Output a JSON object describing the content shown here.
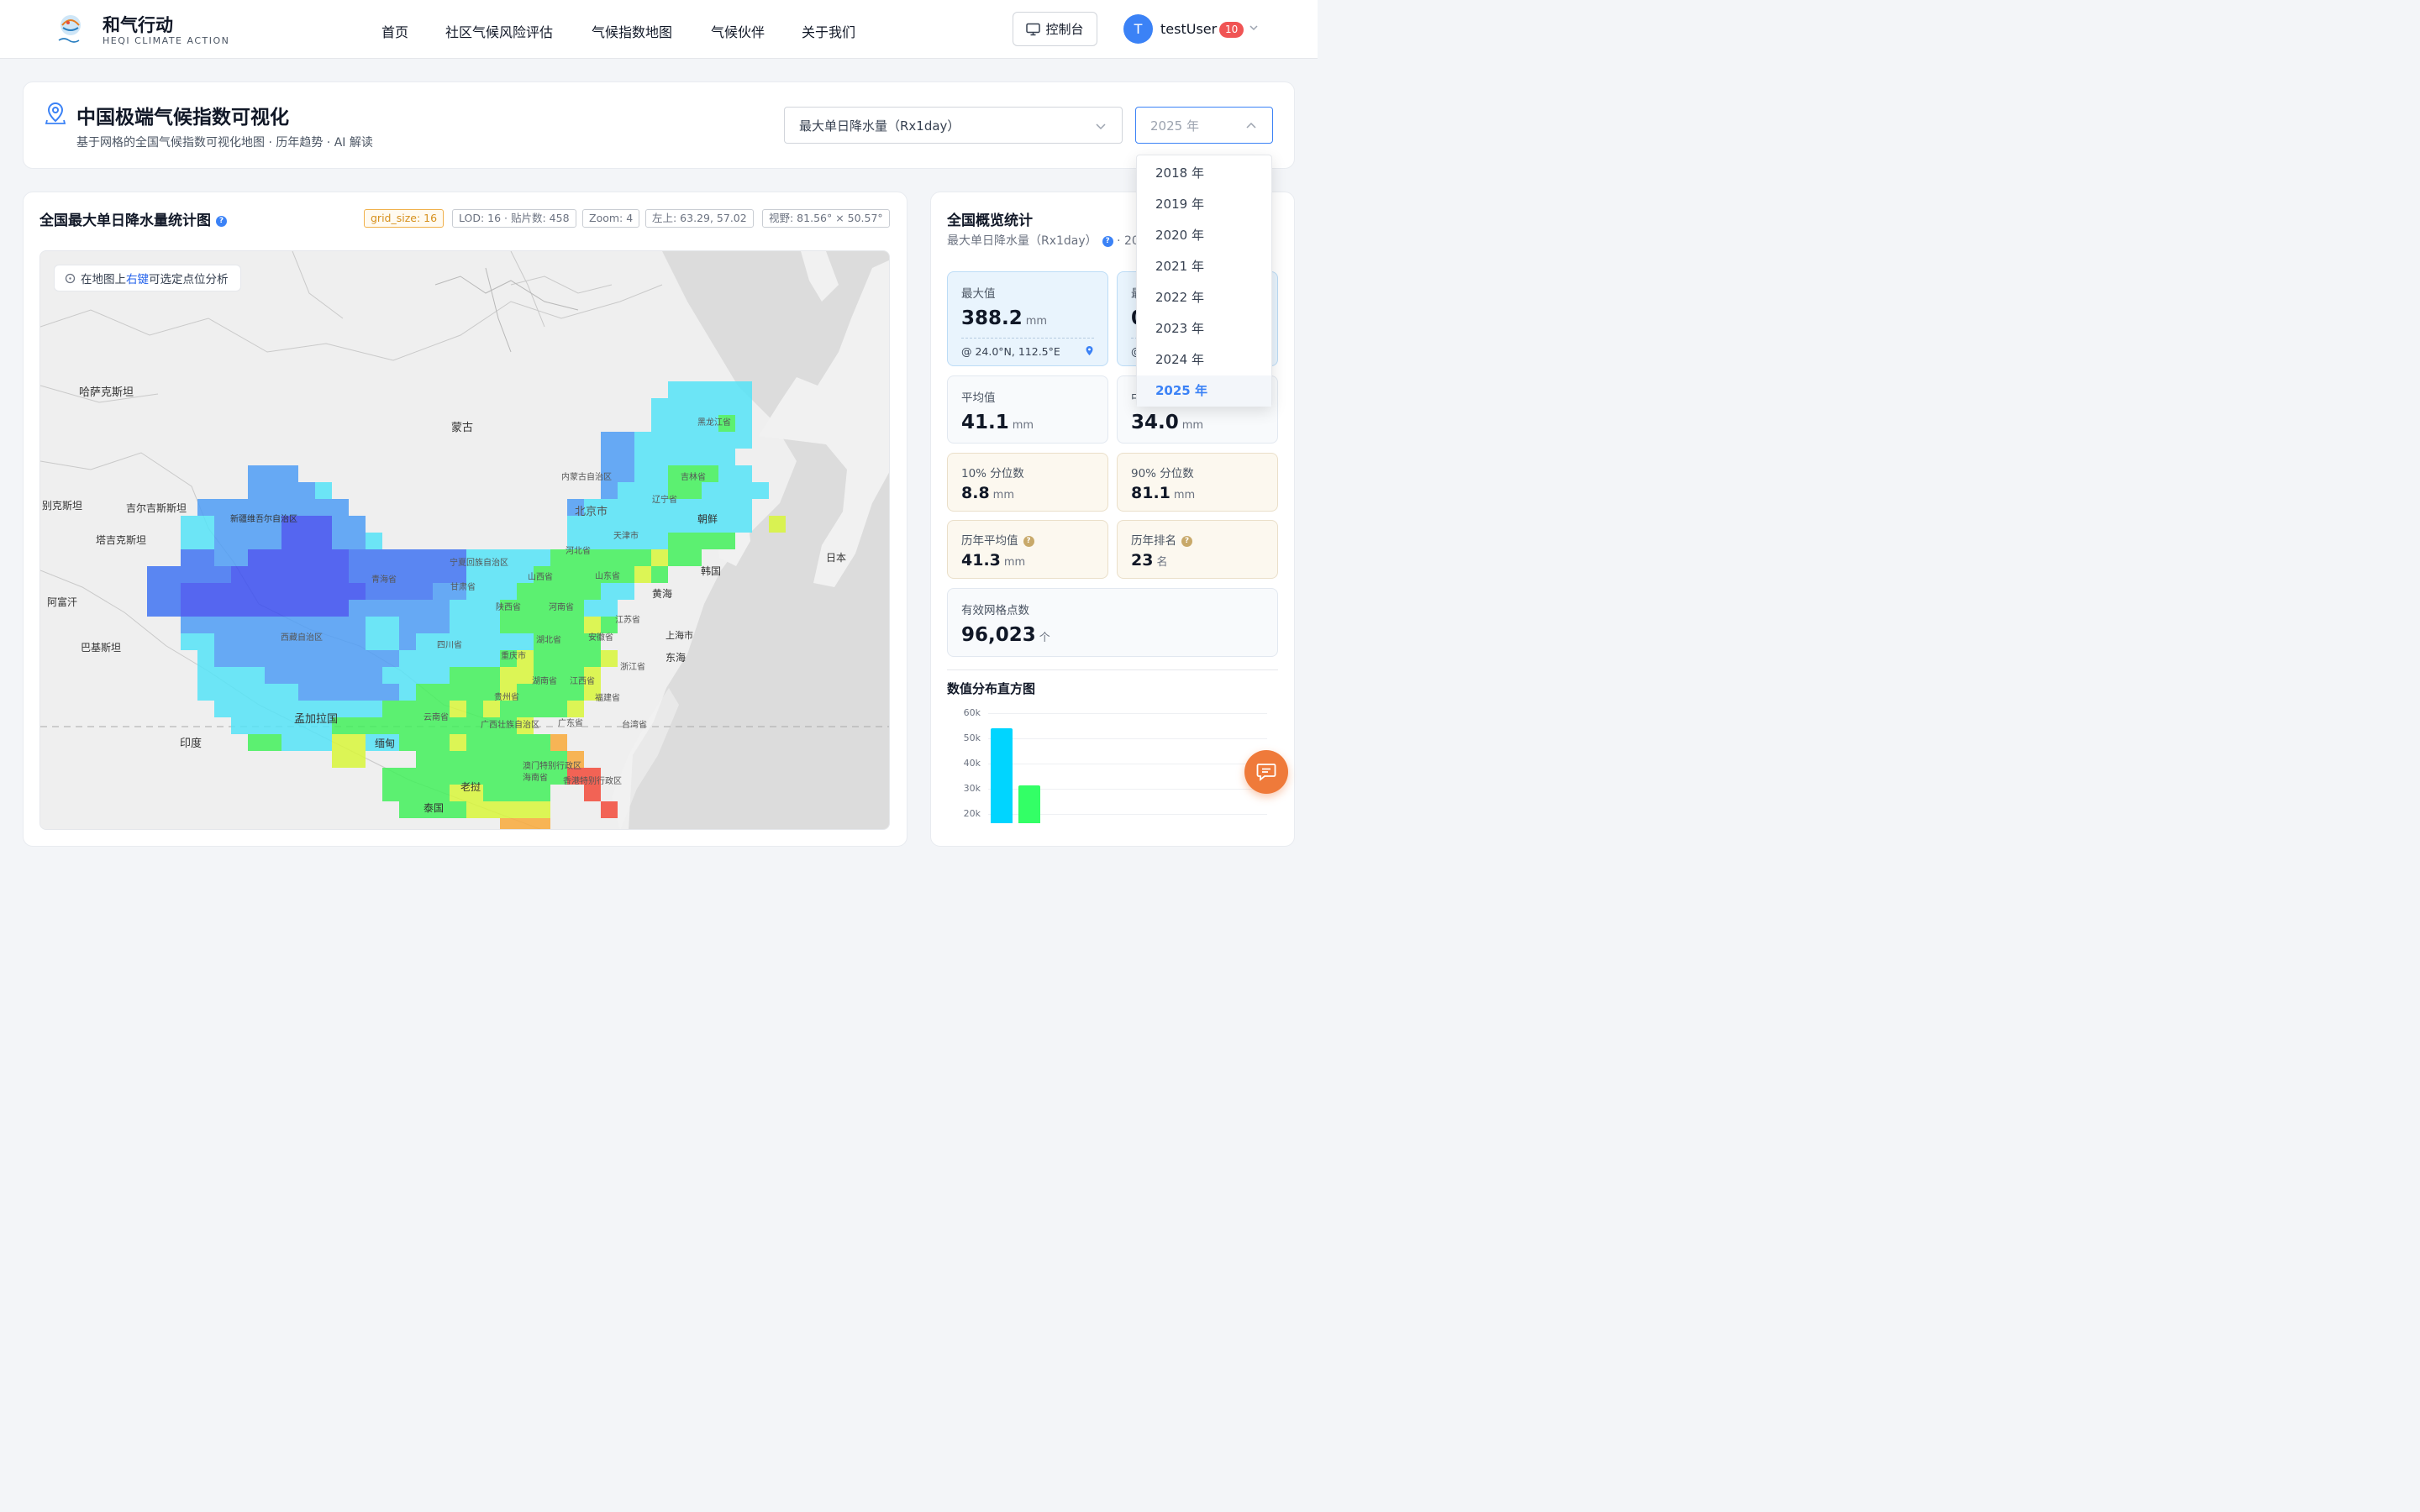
{
  "brand": {
    "title": "和气行动",
    "subtitle": "HEQI CLIMATE ACTION"
  },
  "nav": [
    "首页",
    "社区气候风险评估",
    "气候指数地图",
    "气候伙伴",
    "关于我们"
  ],
  "header": {
    "console_label": "控制台",
    "avatar_letter": "T",
    "username": "testUser",
    "notification_count": "10"
  },
  "page": {
    "title": "中国极端气候指数可视化",
    "subtitle": "基于网格的全国气候指数可视化地图 · 历年趋势 · AI 解读",
    "index_select": "最大单日降水量（Rx1day）",
    "year_select": "2025 年"
  },
  "map_panel": {
    "title": "全国最大单日降水量统计图",
    "chips": [
      "grid_size: 16",
      "LOD: 16 · 贴片数: 458",
      "Zoom: 4",
      "左上: 63.29, 57.02",
      "视野: 81.56° × 50.57°"
    ],
    "hint_pre": "在地图上",
    "hint_key": "右键",
    "hint_post": "可选定点位分析",
    "labels": {
      "kazakhstan": "哈萨克斯坦",
      "mongolia": "蒙古",
      "uzbekistan": "别克斯坦",
      "kyrgyzstan": "吉尔吉斯斯坦",
      "tajikistan": "塔吉克斯坦",
      "afghanistan": "阿富汗",
      "pakistan": "巴基斯坦",
      "xinjiang": "新疆维吾尔自治区",
      "qinghai": "青海省",
      "tibet": "西藏自治区",
      "gansu": "甘肃省",
      "ningxia": "宁夏回族自治区",
      "innermongolia": "内蒙古自治区",
      "beijing": "北京市",
      "tianjin": "天津市",
      "hebei": "河北省",
      "shanxi": "山西省",
      "shandong": "山东省",
      "henan": "河南省",
      "shaanxi": "陕西省",
      "sichuan": "四川省",
      "chongqing": "重庆市",
      "hubei": "湖北省",
      "anhui": "安徽省",
      "jiangsu": "江苏省",
      "shanghai": "上海市",
      "zhejiang": "浙江省",
      "hunan": "湖南省",
      "jiangxi": "江西省",
      "fujian": "福建省",
      "guizhou": "贵州省",
      "yunnan": "云南省",
      "guangxi": "广西壮族自治区",
      "guangdong": "广东省",
      "taiwan": "台湾省",
      "macau": "澳门特别行政区",
      "hongkong": "香港特别行政区",
      "hainan": "海南省",
      "heilongjiang": "黑龙江省",
      "jilin": "吉林省",
      "liaoning": "辽宁省",
      "korea_n": "朝鲜",
      "korea_s": "韩国",
      "japan": "日本",
      "yellowsea": "黄海",
      "eastsea": "东海",
      "bangladesh": "孟加拉国",
      "india": "印度",
      "myanmar": "缅甸",
      "laos": "老挝",
      "thailand": "泰国"
    }
  },
  "stats": {
    "title": "全国概览统计",
    "subtitle_index": "最大单日降水量（Rx1day）",
    "subtitle_year": "· 202",
    "max": {
      "label": "最大值",
      "value": "388.2",
      "unit": "mm",
      "loc": "@ 24.0°N, 112.5°E"
    },
    "min": {
      "label": "最",
      "value": "0",
      "loc": "@"
    },
    "mean": {
      "label": "平均值",
      "value": "41.1",
      "unit": "mm"
    },
    "median": {
      "label": "中",
      "value": "34.0",
      "unit": "mm"
    },
    "p10": {
      "label": "10% 分位数",
      "value": "8.8",
      "unit": "mm"
    },
    "p90": {
      "label": "90% 分位数",
      "value": "81.1",
      "unit": "mm"
    },
    "hist_mean": {
      "label": "历年平均值",
      "value": "41.3",
      "unit": "mm"
    },
    "rank": {
      "label": "历年排名",
      "value": "23",
      "unit": "名"
    },
    "cells": {
      "label": "有效网格点数",
      "value": "96,023",
      "unit": "个"
    },
    "histogram_title": "数值分布直方图"
  },
  "histogram": {
    "ticks": [
      "60k",
      "50k",
      "40k",
      "30k",
      "20k"
    ],
    "tick_values": [
      60000,
      50000,
      40000,
      30000,
      20000
    ],
    "bars": [
      {
        "value": 54000,
        "color": "#00d5ff"
      },
      {
        "value": 31500,
        "color": "#33ff66"
      }
    ]
  },
  "year_dropdown": [
    "2018 年",
    "2019 年",
    "2020 年",
    "2021 年",
    "2022 年",
    "2023 年",
    "2024 年",
    "2025 年"
  ],
  "year_selected": "2025 年",
  "colors": {
    "accent": "#3b82f6",
    "chat": "#ef7a3a",
    "badge": "#f05454"
  }
}
